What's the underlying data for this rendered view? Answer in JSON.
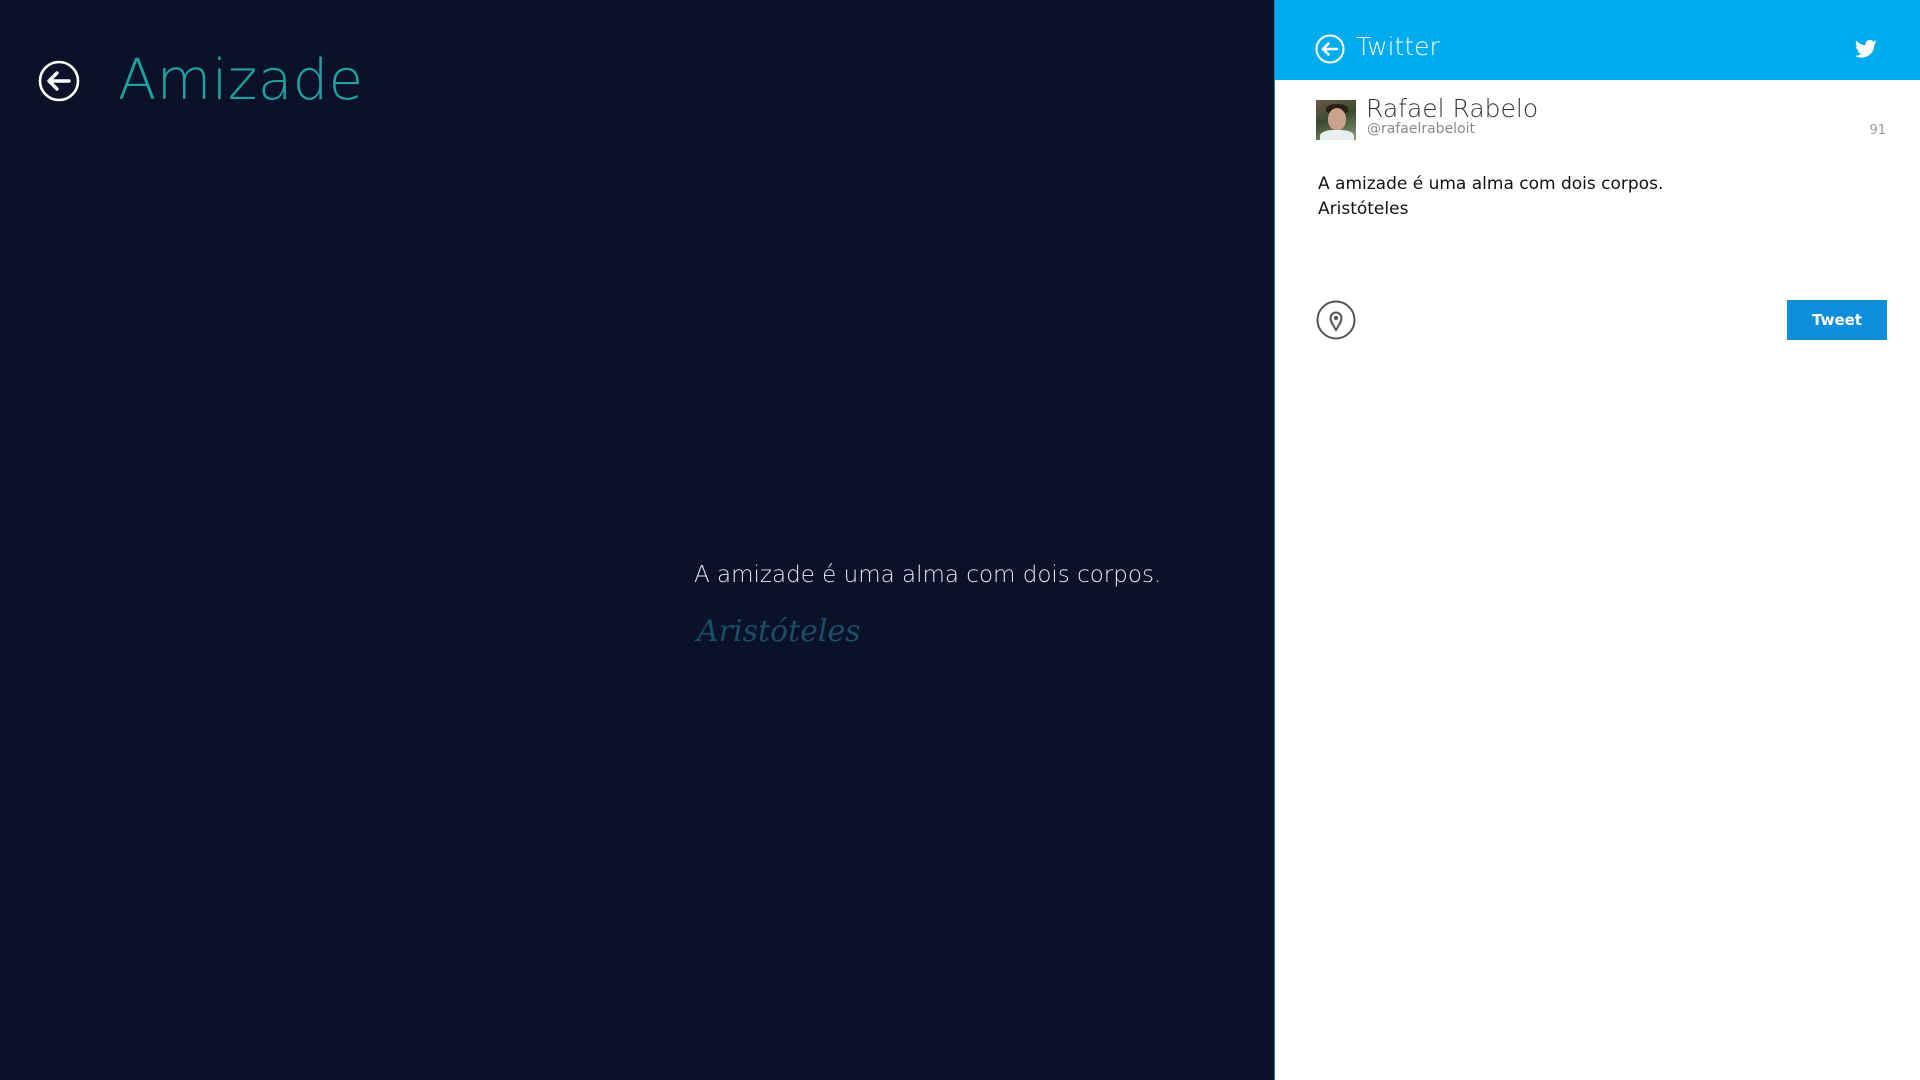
{
  "app": {
    "title": "Amizade",
    "back_icon": "back-arrow-circle-icon",
    "quote": {
      "text": "A amizade é uma alma com dois corpos.",
      "author": "Aristóteles"
    }
  },
  "share": {
    "title": "Twitter",
    "back_icon": "back-arrow-circle-icon",
    "brand_icon": "twitter-bird-icon",
    "user": {
      "name": "Rafael Rabelo",
      "handle": "@rafaelrabeloit"
    },
    "char_count": "91",
    "tweet_text": "A amizade é uma alma com dois corpos.\nAristóteles",
    "location_icon": "map-pin-icon",
    "tweet_label": "Tweet"
  },
  "colors": {
    "app_background": "#0b1128",
    "title_accent": "#1aa3a0",
    "author_color": "#184f66",
    "share_header": "#00acee",
    "tweet_button": "#0f8edc"
  }
}
